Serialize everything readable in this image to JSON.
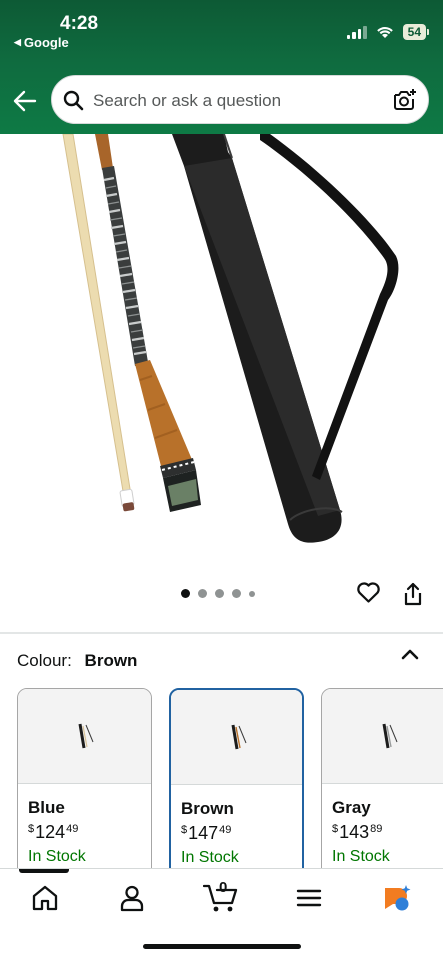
{
  "status_bar": {
    "time": "4:28",
    "back_app": "Google",
    "battery": "54"
  },
  "search": {
    "placeholder": "Search or ask a question"
  },
  "carousel": {
    "image_count": 5,
    "active_index": 0
  },
  "colour": {
    "label": "Colour:",
    "selected": "Brown"
  },
  "swatches": [
    {
      "name": "Blue",
      "currency": "$",
      "whole": "124",
      "cents": "49",
      "stock": "In Stock",
      "selected": false
    },
    {
      "name": "Brown",
      "currency": "$",
      "whole": "147",
      "cents": "49",
      "stock": "In Stock",
      "selected": true
    },
    {
      "name": "Gray",
      "currency": "$",
      "whole": "143",
      "cents": "89",
      "stock": "In Stock",
      "selected": false
    }
  ],
  "nav": {
    "cart_count": "0",
    "items": [
      "home-icon",
      "account-icon",
      "cart-icon",
      "menu-icon",
      "rufus-icon"
    ]
  },
  "colors": {
    "header_green": "#0f6b3f",
    "selected_border": "#2162a1",
    "in_stock": "#007600",
    "rufus_orange": "#f27c21",
    "rufus_blue": "#2f7fd8"
  }
}
